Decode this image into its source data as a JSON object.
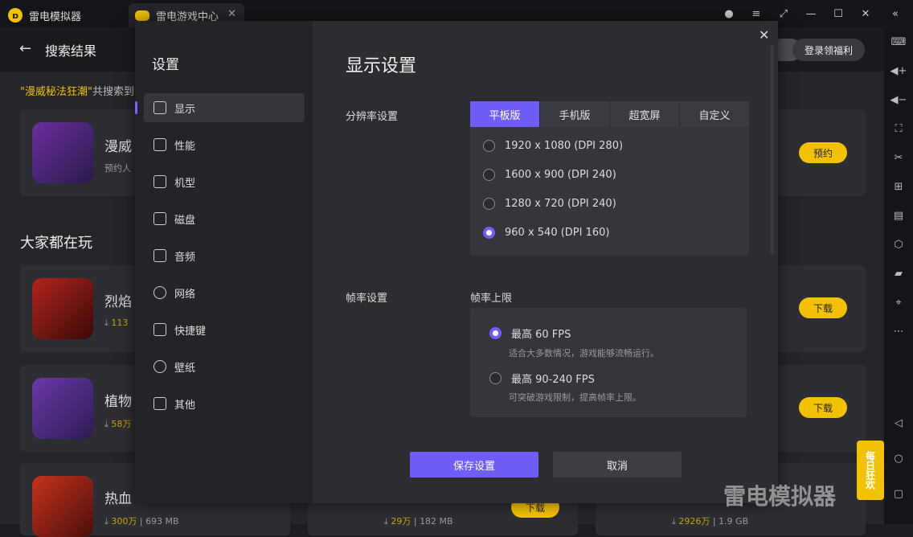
{
  "app": {
    "tab1": "雷电模拟器",
    "tab2": "雷电游戏中心"
  },
  "header": {
    "back_icon": "←",
    "title": "搜索结果",
    "login": "登录领福利"
  },
  "search": {
    "query": "\"漫威秘法狂潮\"",
    "result_prefix": "共搜索到"
  },
  "games": [
    {
      "name": "漫威",
      "sub": "预约人",
      "btn": "预约"
    },
    {
      "name": "烈焰",
      "sub_count": "113",
      "btn": "下载"
    },
    {
      "name": "植物",
      "sub_count": "58万",
      "btn": "下载"
    },
    {
      "name": "热血",
      "sub_count": "300万",
      "sub_size": "693 MB",
      "btn": "下载"
    }
  ],
  "section": {
    "popular": "大家都在玩"
  },
  "bottom_row": [
    {
      "count": "29万",
      "size": "182 MB",
      "btn": "下载"
    },
    {
      "count": "2926万",
      "size": "1.9 GB"
    }
  ],
  "settings": {
    "title": "设置",
    "nav": [
      {
        "label": "显示",
        "icon": "monitor-icon"
      },
      {
        "label": "性能",
        "icon": "pulse-icon"
      },
      {
        "label": "机型",
        "icon": "folder-icon"
      },
      {
        "label": "磁盘",
        "icon": "disk-icon"
      },
      {
        "label": "音频",
        "icon": "gamepad-icon"
      },
      {
        "label": "网络",
        "icon": "globe-icon"
      },
      {
        "label": "快捷键",
        "icon": "keyboard-icon"
      },
      {
        "label": "壁纸",
        "icon": "palette-icon"
      },
      {
        "label": "其他",
        "icon": "grid-icon"
      }
    ],
    "content_title": "显示设置",
    "resolution_label": "分辨率设置",
    "tabs": [
      "平板版",
      "手机版",
      "超宽屏",
      "自定义"
    ],
    "resolutions": [
      "1920 x 1080  (DPI 280)",
      "1600 x 900  (DPI 240)",
      "1280 x 720  (DPI 240)",
      "960 x 540  (DPI 160)"
    ],
    "fps_label": "帧率设置",
    "fps_limit_label": "帧率上限",
    "fps_options": [
      {
        "label": "最高 60 FPS",
        "desc": "适合大多数情况，游戏能够流畅运行。"
      },
      {
        "label": "最高 90-240 FPS",
        "desc": "可突破游戏限制，提高帧率上限。"
      }
    ],
    "save": "保存设置",
    "cancel": "取消"
  },
  "watermark": "雷电模拟器",
  "daily": "每日狂欢",
  "colors": {
    "accent": "#6f5df8",
    "brand": "#f2c200"
  }
}
